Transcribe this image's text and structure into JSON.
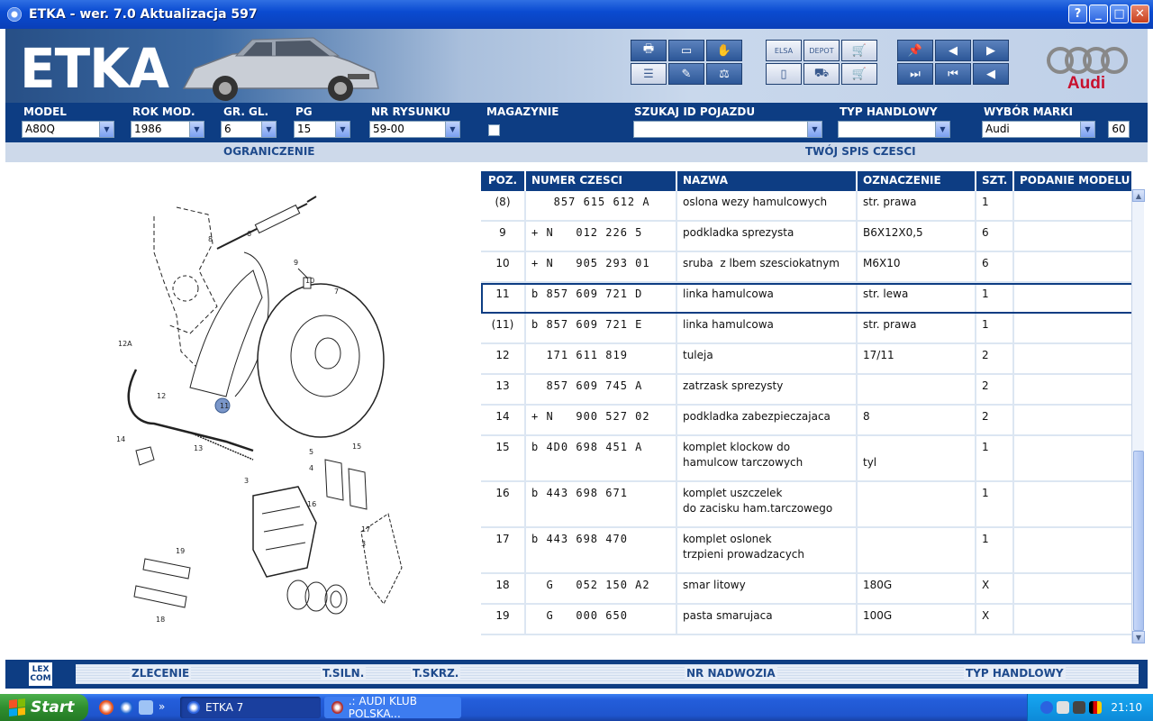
{
  "window": {
    "title": "ETKA - wer. 7.0 Aktualizacja 597",
    "help": "?",
    "minimize": "_",
    "maximize": "□",
    "close": "✕"
  },
  "header": {
    "logo": "ETKA",
    "brand": "Audi",
    "tools": [
      "printer-icon",
      "window-icon",
      "handshake-icon",
      "list-icon",
      "pencil-icon",
      "scale-icon",
      "elsa-icon",
      "depot-icon",
      "cart-icon",
      "devices-icon",
      "truck-icon",
      "shopping-cart-icon",
      "pin-icon",
      "prev-page-icon",
      "next-page-icon",
      "last-icon",
      "first-icon",
      "back-icon"
    ],
    "elsa_label": "ELSA",
    "depot_label": "DEPOT"
  },
  "filters": {
    "model_label": "MODEL",
    "model_value": "A80Q",
    "year_label": "ROK MOD.",
    "year_value": "1986",
    "group_label": "GR. GL.",
    "group_value": "6",
    "pg_label": "PG",
    "pg_value": "15",
    "drawing_label": "NR RYSUNKU",
    "drawing_value": "59-00",
    "warehouse_label": "MAGAZYNIE",
    "vehicle_label": "SZUKAJ ID POJAZDU",
    "vehicle_value": "",
    "trade_label": "TYP HANDLOWY",
    "trade_value": "",
    "brand_label": "WYBÓR MARKI",
    "brand_value": "Audi",
    "count_value": "60"
  },
  "sections": {
    "left": "OGRANICZENIE",
    "right": "TWÓJ SPIS CZESCI"
  },
  "table": {
    "columns": [
      "POZ.",
      "NUMER CZESCI",
      "NAZWA",
      "OZNACZENIE",
      "SZT.",
      "PODANIE MODELU"
    ],
    "rows": [
      {
        "poz": "(8)",
        "num": "   857 615 612 A",
        "name": "oslona wezy hamulcowych",
        "desc": "str. prawa",
        "qty": "1",
        "model": ""
      },
      {
        "poz": "9",
        "num": "+ N   012 226 5",
        "name": "podkladka sprezysta",
        "desc": "B6X12X0,5",
        "qty": "6",
        "model": ""
      },
      {
        "poz": "10",
        "num": "+ N   905 293 01",
        "name": "sruba  z lbem szesciokatnym",
        "desc": "M6X10",
        "qty": "6",
        "model": ""
      },
      {
        "poz": "11",
        "num": "b 857 609 721 D",
        "name": "linka hamulcowa",
        "desc": "str. lewa",
        "qty": "1",
        "model": ""
      },
      {
        "poz": "(11)",
        "num": "b 857 609 721 E",
        "name": "linka hamulcowa",
        "desc": "str. prawa",
        "qty": "1",
        "model": ""
      },
      {
        "poz": "12",
        "num": "  171 611 819",
        "name": "tuleja",
        "desc": "17/11",
        "qty": "2",
        "model": ""
      },
      {
        "poz": "13",
        "num": "  857 609 745 A",
        "name": "zatrzask sprezysty",
        "desc": "",
        "qty": "2",
        "model": ""
      },
      {
        "poz": "14",
        "num": "+ N   900 527 02",
        "name": "podkladka zabezpieczajaca",
        "desc": "8",
        "qty": "2",
        "model": ""
      },
      {
        "poz": "15",
        "num": "b 4D0 698 451 A",
        "name": "komplet klockow do\nhamulcow tarczowych",
        "desc": "\ntyl",
        "qty": "1",
        "model": ""
      },
      {
        "poz": "16",
        "num": "b 443 698 671",
        "name": "komplet uszczelek\ndo zacisku ham.tarczowego",
        "desc": "",
        "qty": "1",
        "model": ""
      },
      {
        "poz": "17",
        "num": "b 443 698 470",
        "name": "komplet oslonek\ntrzpieni prowadzacych",
        "desc": "",
        "qty": "1",
        "model": ""
      },
      {
        "poz": "18",
        "num": "  G   052 150 A2",
        "name": "smar litowy",
        "desc": "180G",
        "qty": "X",
        "model": ""
      },
      {
        "poz": "19",
        "num": "  G   000 650",
        "name": "pasta smarujaca",
        "desc": "100G",
        "qty": "X",
        "model": ""
      }
    ],
    "selected_index": 3
  },
  "drawing": {
    "labels": [
      "6",
      "8",
      "9",
      "10",
      "7",
      "12A",
      "11",
      "12",
      "14",
      "13",
      "3",
      "5",
      "4",
      "15",
      "16",
      "17",
      "3",
      "19",
      "18",
      "16"
    ]
  },
  "bottom": {
    "lexcom": "LEX\nCOM",
    "items": [
      "ZLECENIE",
      "T.SILN.",
      "T.SKRZ.",
      "NR NADWOZIA",
      "TYP HANDLOWY"
    ]
  },
  "taskbar": {
    "start": "Start",
    "chevron": "»",
    "tasks": [
      "ETKA 7",
      ".: AUDI KLUB POLSKA..."
    ],
    "clock": "21:10"
  },
  "colors": {
    "navy": "#0d3d83",
    "accent": "#1e4a8c",
    "audi_red": "#c8102e"
  }
}
